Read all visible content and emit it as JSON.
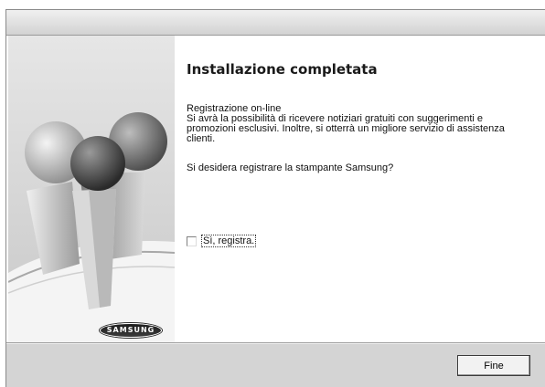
{
  "window": {
    "title": ""
  },
  "branding": {
    "logo_text": "SAMSUNG"
  },
  "main": {
    "heading": "Installazione completata",
    "paragraph_lines": [
      "Registrazione on-line",
      "Si avrà la possibilità di ricevere notiziari gratuiti con suggerimenti e",
      "promozioni esclusivi. Inoltre, si otterrà un migliore servizio di assistenza",
      "clienti."
    ],
    "question": "Si desidera registrare la stampante Samsung?",
    "register_checkbox": {
      "label": "Sì, registra.",
      "checked": false
    }
  },
  "footer": {
    "finish_label": "Fine"
  },
  "colors": {
    "panel_gray": "#d6d6d6",
    "footer_gray": "#d4d4d4"
  }
}
